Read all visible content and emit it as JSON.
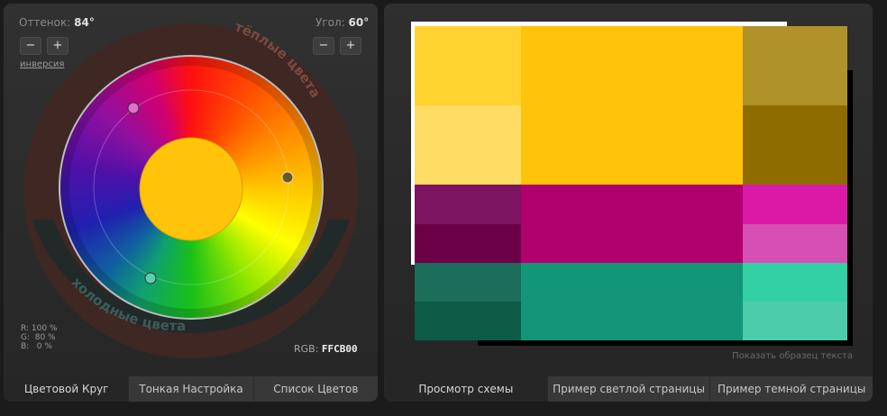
{
  "left": {
    "hue_label": "Оттенок:",
    "hue_value": "84°",
    "angle_label": "Угол:",
    "angle_value": "60°",
    "minus": "−",
    "plus": "+",
    "inversion": "инверсия",
    "warm": "тёплые цвета",
    "cold": "холодные цвета",
    "rgb_r": "R: 100 %",
    "rgb_g": "G:  80 %",
    "rgb_b": "B:   0 %",
    "rgb_label": "RGB:",
    "rgb_hex": "FFCB00",
    "center_color": "#ffc40a",
    "markers": [
      "#e070c8",
      "#6b5a1a",
      "#5ccfb0"
    ],
    "tabs": [
      "Цветовой Круг",
      "Тонкая Настройка",
      "Список Цветов"
    ]
  },
  "right": {
    "sample_text": "Показать образец текста",
    "tabs": [
      "Просмотр схемы",
      "Пример светлой страницы",
      "Пример темной страницы"
    ],
    "colors": {
      "yellow_main": "#ffc30b",
      "yellow_light1": "#ffd230",
      "yellow_light2": "#ffdc63",
      "yellow_dark1": "#b0922a",
      "yellow_dark2": "#8f6c00",
      "magenta_main": "#b0006e",
      "magenta_dark1": "#7c1461",
      "magenta_dark2": "#6b0046",
      "magenta_light1": "#da1aa6",
      "magenta_light2": "#d54fb3",
      "teal_main": "#139677",
      "teal_dark1": "#1c6e5a",
      "teal_dark2": "#0c5b47",
      "teal_light1": "#33cfa5",
      "teal_light2": "#4dccac"
    }
  }
}
